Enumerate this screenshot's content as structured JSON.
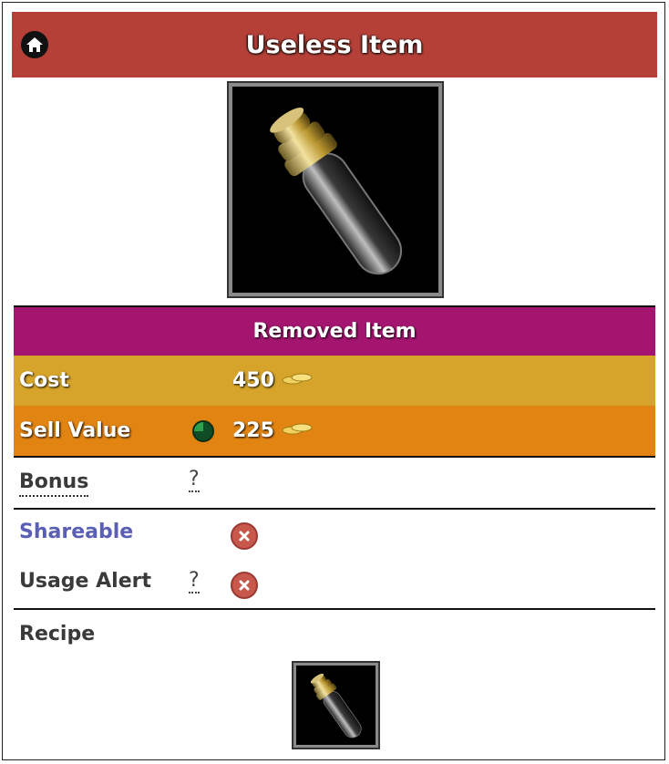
{
  "header": {
    "title": "Useless Item",
    "home_icon": "home-icon",
    "background_color": "#b44038"
  },
  "item": {
    "image_icon": "bottle-icon"
  },
  "status_banner": {
    "label": "Removed Item",
    "color": "#a3156e"
  },
  "cost": {
    "label": "Cost",
    "value": "450",
    "icon": "gold-coins-icon",
    "color": "#d6a42a"
  },
  "sell_value": {
    "label": "Sell Value",
    "value": "225",
    "timer_icon": "timer-icon",
    "icon": "gold-coins-icon",
    "color": "#e28412"
  },
  "bonus": {
    "label": "Bonus",
    "help": "?"
  },
  "shareable": {
    "label": "Shareable",
    "status_icon": "close-circle-icon"
  },
  "usage_alert": {
    "label": "Usage Alert",
    "help": "?",
    "status_icon": "close-circle-icon"
  },
  "recipe": {
    "label": "Recipe",
    "item_icon": "bottle-icon"
  }
}
